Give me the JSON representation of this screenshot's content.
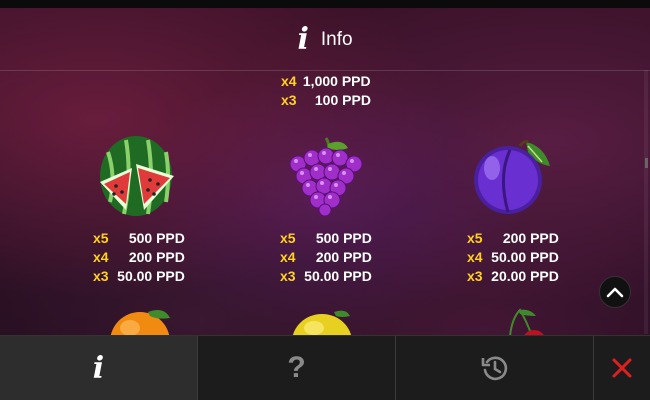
{
  "header": {
    "title": "Info",
    "icon": "info-icon"
  },
  "paytable": {
    "top_partial": [
      {
        "mult": "x4",
        "amount": "1,000 PPD"
      },
      {
        "mult": "x3",
        "amount": "100 PPD"
      }
    ],
    "watermelon": [
      {
        "mult": "x5",
        "amount": "500 PPD"
      },
      {
        "mult": "x4",
        "amount": "200 PPD"
      },
      {
        "mult": "x3",
        "amount": "50.00 PPD"
      }
    ],
    "grapes": [
      {
        "mult": "x5",
        "amount": "500 PPD"
      },
      {
        "mult": "x4",
        "amount": "200 PPD"
      },
      {
        "mult": "x3",
        "amount": "50.00 PPD"
      }
    ],
    "plum": [
      {
        "mult": "x5",
        "amount": "200 PPD"
      },
      {
        "mult": "x4",
        "amount": "50.00 PPD"
      },
      {
        "mult": "x3",
        "amount": "20.00 PPD"
      }
    ]
  },
  "bottom_bar": {
    "info_tab": "info-icon",
    "help_tab": "?",
    "history_tab": "history-icon",
    "close": "close-icon"
  },
  "colors": {
    "multiplier": "#ffd21e",
    "close": "#e02020",
    "accent_active_tab": "#2d2d2d"
  }
}
